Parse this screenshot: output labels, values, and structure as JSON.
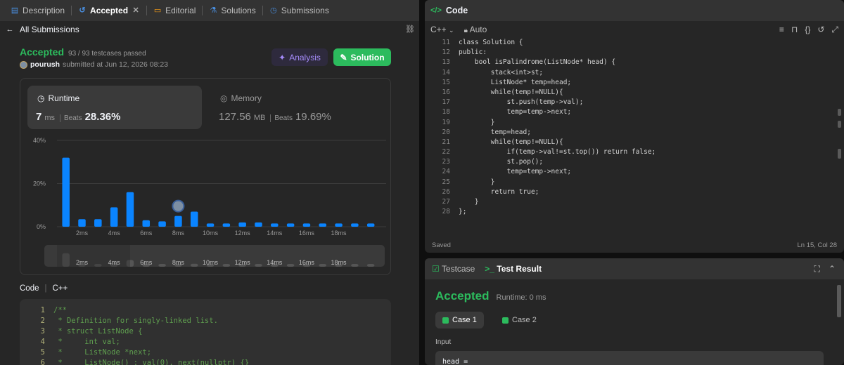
{
  "left_tabs": [
    {
      "label": "Description",
      "icon": "document-icon"
    },
    {
      "label": "Accepted",
      "icon": "history-icon"
    },
    {
      "label": "Editorial",
      "icon": "book-icon"
    },
    {
      "label": "Solutions",
      "icon": "flask-icon"
    },
    {
      "label": "Submissions",
      "icon": "clock-icon"
    }
  ],
  "back_label": "All Submissions",
  "result": {
    "status": "Accepted",
    "testcases": "93 / 93 testcases passed",
    "user": "pourush",
    "submitted": "submitted at Jun 12, 2026 08:23"
  },
  "buttons": {
    "analysis": "Analysis",
    "solution": "Solution"
  },
  "runtime": {
    "label": "Runtime",
    "value": "7",
    "unit": "ms",
    "beats_label": "Beats",
    "beats": "28.36%"
  },
  "memory": {
    "label": "Memory",
    "value": "127.56",
    "unit": "MB",
    "beats_label": "Beats",
    "beats": "19.69%"
  },
  "chart_data": {
    "type": "bar",
    "ylabel_ticks": [
      "40%",
      "20%",
      "0%"
    ],
    "ylim": [
      0,
      40
    ],
    "x_tick_labels": [
      "2ms",
      "4ms",
      "6ms",
      "8ms",
      "10ms",
      "12ms",
      "14ms",
      "16ms",
      "18ms"
    ],
    "categories": [
      "1ms",
      "2ms",
      "3ms",
      "4ms",
      "5ms",
      "6ms",
      "7ms",
      "8ms",
      "9ms",
      "10ms",
      "11ms",
      "12ms",
      "13ms",
      "14ms",
      "15ms",
      "16ms",
      "17ms",
      "18ms",
      "19ms",
      "20ms"
    ],
    "values": [
      32,
      3.5,
      3.5,
      9,
      16,
      3,
      2.5,
      5,
      7,
      1.5,
      1.5,
      2,
      2,
      1.5,
      1.5,
      1.5,
      1.5,
      1.5,
      1.5,
      1.5
    ],
    "highlight_index": 7,
    "bar_color": "#0a84ff"
  },
  "code_section": {
    "label": "Code",
    "lang": "C++"
  },
  "submitted_code": [
    {
      "n": "1",
      "t": "/**"
    },
    {
      "n": "2",
      "t": " * Definition for singly-linked list."
    },
    {
      "n": "3",
      "t": " * struct ListNode {"
    },
    {
      "n": "4",
      "t": " *     int val;"
    },
    {
      "n": "5",
      "t": " *     ListNode *next;"
    },
    {
      "n": "6",
      "t": " *     ListNode() : val(0), next(nullptr) {}"
    }
  ],
  "editor": {
    "title": "Code",
    "lang": "C++",
    "mode": "Auto",
    "saved": "Saved",
    "cursor": "Ln 15, Col 28",
    "lines": [
      {
        "n": "11",
        "t": "class Solution {"
      },
      {
        "n": "12",
        "t": "public:"
      },
      {
        "n": "13",
        "t": "    bool isPalindrome(ListNode* head) {"
      },
      {
        "n": "14",
        "t": "        stack<int>st;"
      },
      {
        "n": "15",
        "t": "        ListNode* temp=head;"
      },
      {
        "n": "16",
        "t": "        while(temp!=NULL){"
      },
      {
        "n": "17",
        "t": "            st.push(temp->val);"
      },
      {
        "n": "18",
        "t": "            temp=temp->next;"
      },
      {
        "n": "19",
        "t": "        }"
      },
      {
        "n": "20",
        "t": "        temp=head;"
      },
      {
        "n": "21",
        "t": "        while(temp!=NULL){"
      },
      {
        "n": "22",
        "t": "            if(temp->val!=st.top()) return false;"
      },
      {
        "n": "23",
        "t": "            st.pop();"
      },
      {
        "n": "24",
        "t": "            temp=temp->next;"
      },
      {
        "n": "25",
        "t": "        }"
      },
      {
        "n": "26",
        "t": "        return true;"
      },
      {
        "n": "27",
        "t": "    }"
      },
      {
        "n": "28",
        "t": "};"
      }
    ]
  },
  "test_panel": {
    "tab_testcase": "Testcase",
    "tab_result": "Test Result",
    "status": "Accepted",
    "runtime": "Runtime: 0 ms",
    "case1": "Case 1",
    "case2": "Case 2",
    "input_label": "Input",
    "input_value": "head ="
  }
}
